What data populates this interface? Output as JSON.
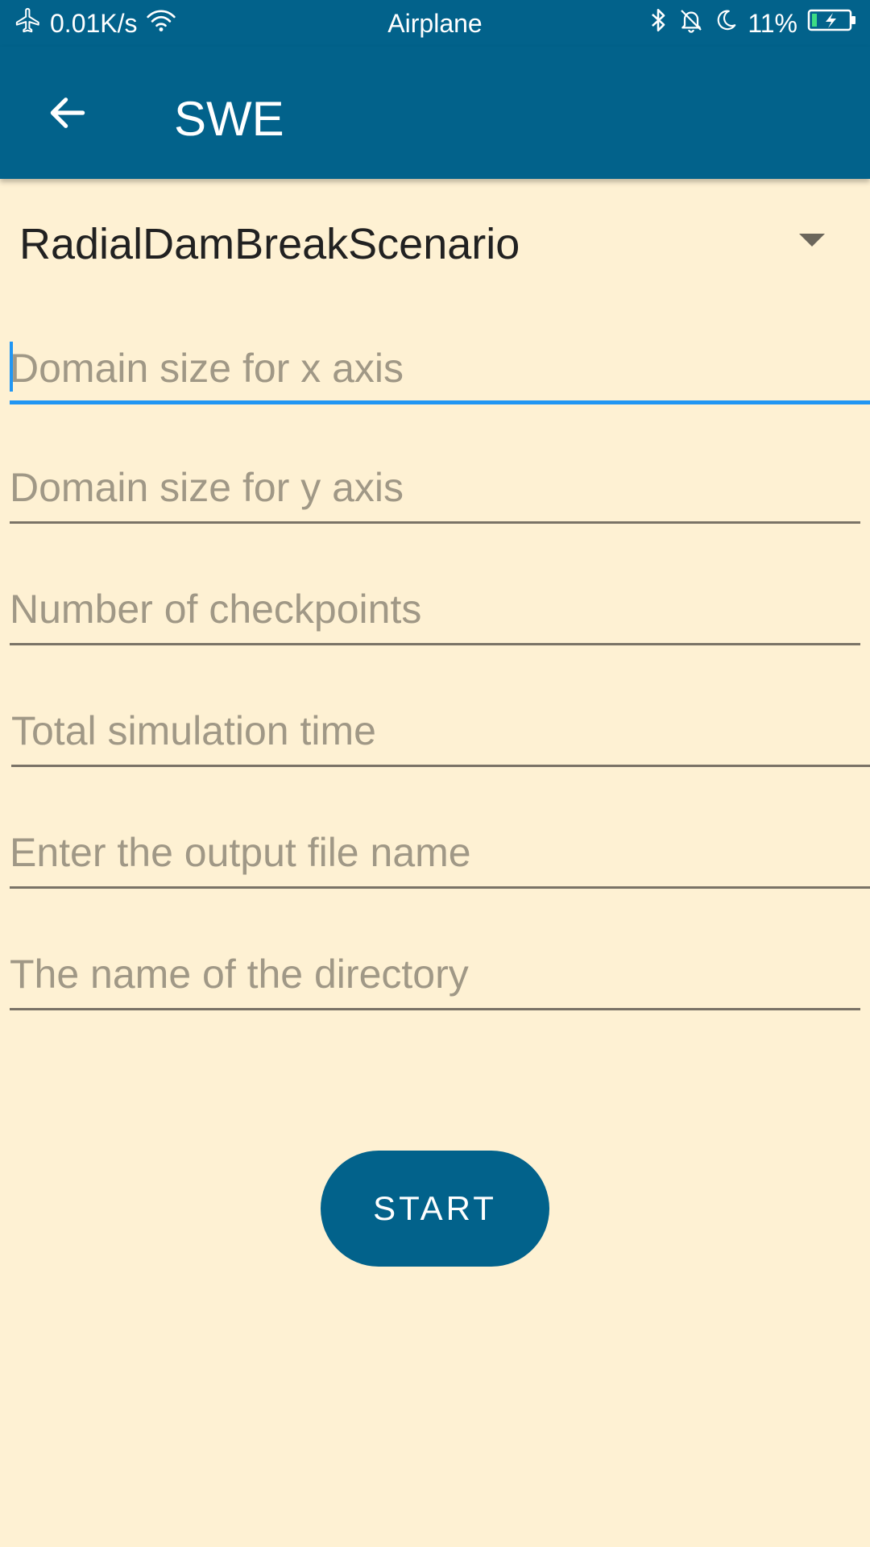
{
  "status_bar": {
    "speed": "0.01K/s",
    "mode": "Airplane",
    "battery_percent": "11%",
    "icons": [
      "airplane-icon",
      "wifi-icon",
      "bluetooth-icon",
      "bell-off-icon",
      "moon-icon",
      "battery-charging-icon"
    ]
  },
  "app_bar": {
    "title": "SWE",
    "back_icon": "arrow-back-icon",
    "background": "#02628B"
  },
  "scenario_select": {
    "selected": "RadialDamBreakScenario",
    "arrow_icon": "dropdown-arrow-icon"
  },
  "fields": {
    "domain_x": {
      "placeholder": "Domain size for x axis",
      "value": ""
    },
    "domain_y": {
      "placeholder": "Domain size for y axis",
      "value": ""
    },
    "checkpoints": {
      "placeholder": "Number of checkpoints",
      "value": ""
    },
    "sim_time": {
      "placeholder": "Total simulation time",
      "value": ""
    },
    "output_file": {
      "placeholder": "Enter the output file name",
      "value": ""
    },
    "directory": {
      "placeholder": "The name of the directory",
      "value": ""
    }
  },
  "start_button": {
    "label": "START"
  },
  "colors": {
    "primary": "#02628B",
    "background": "#FEF1D3",
    "focus": "#2196F3",
    "placeholder": "#A09886"
  }
}
